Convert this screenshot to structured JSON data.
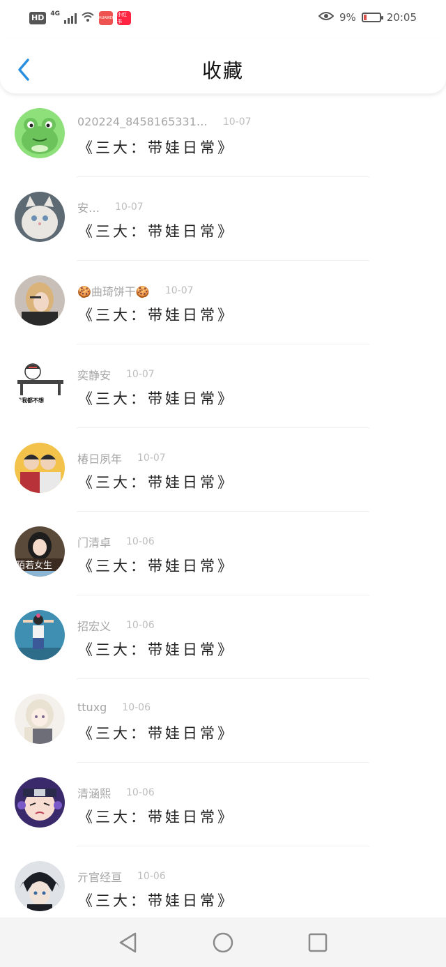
{
  "status_bar": {
    "hd": "HD",
    "network": "4G",
    "app1": "HUAWEI",
    "app2": "小红书",
    "battery_text": "9%",
    "battery_level": 0.09,
    "time": "20:05"
  },
  "header": {
    "title": "收藏",
    "back_icon": "chevron-left-icon",
    "accent_color": "#2b8fe0"
  },
  "favorites": [
    {
      "username": "020224_8458165331…",
      "date": "10-07",
      "content": "《三大：带娃日常》",
      "avatar": "frog-avatar"
    },
    {
      "username": "安…",
      "date": "10-07",
      "content": "《三大：带娃日常》",
      "avatar": "cat-avatar"
    },
    {
      "username": "🍪曲琦饼干🍪",
      "date": "10-07",
      "content": "《三大：带娃日常》",
      "avatar": "girl-avatar"
    },
    {
      "username": "奕静安",
      "date": "10-07",
      "content": "《三大：带娃日常》",
      "avatar": "cartoon-avatar"
    },
    {
      "username": "椿日夙年",
      "date": "10-07",
      "content": "《三大：带娃日常》",
      "avatar": "couple-avatar"
    },
    {
      "username": "门清卓",
      "date": "10-06",
      "content": "《三大：带娃日常》",
      "avatar": "girl-sign-avatar"
    },
    {
      "username": "招宏义",
      "date": "10-06",
      "content": "《三大：带娃日常》",
      "avatar": "wall-girl-avatar"
    },
    {
      "username": "ttuxg",
      "date": "10-06",
      "content": "《三大：带娃日常》",
      "avatar": "anime-girl-avatar"
    },
    {
      "username": "清涵熙",
      "date": "10-06",
      "content": "《三大：带娃日常》",
      "avatar": "naruto-avatar"
    },
    {
      "username": "亓官经亘",
      "date": "10-06",
      "content": "《三大：带娃日常》",
      "avatar": "anime-boy-avatar"
    }
  ],
  "nav": {
    "back": "triangle-back-icon",
    "home": "circle-home-icon",
    "recent": "square-recent-icon"
  }
}
